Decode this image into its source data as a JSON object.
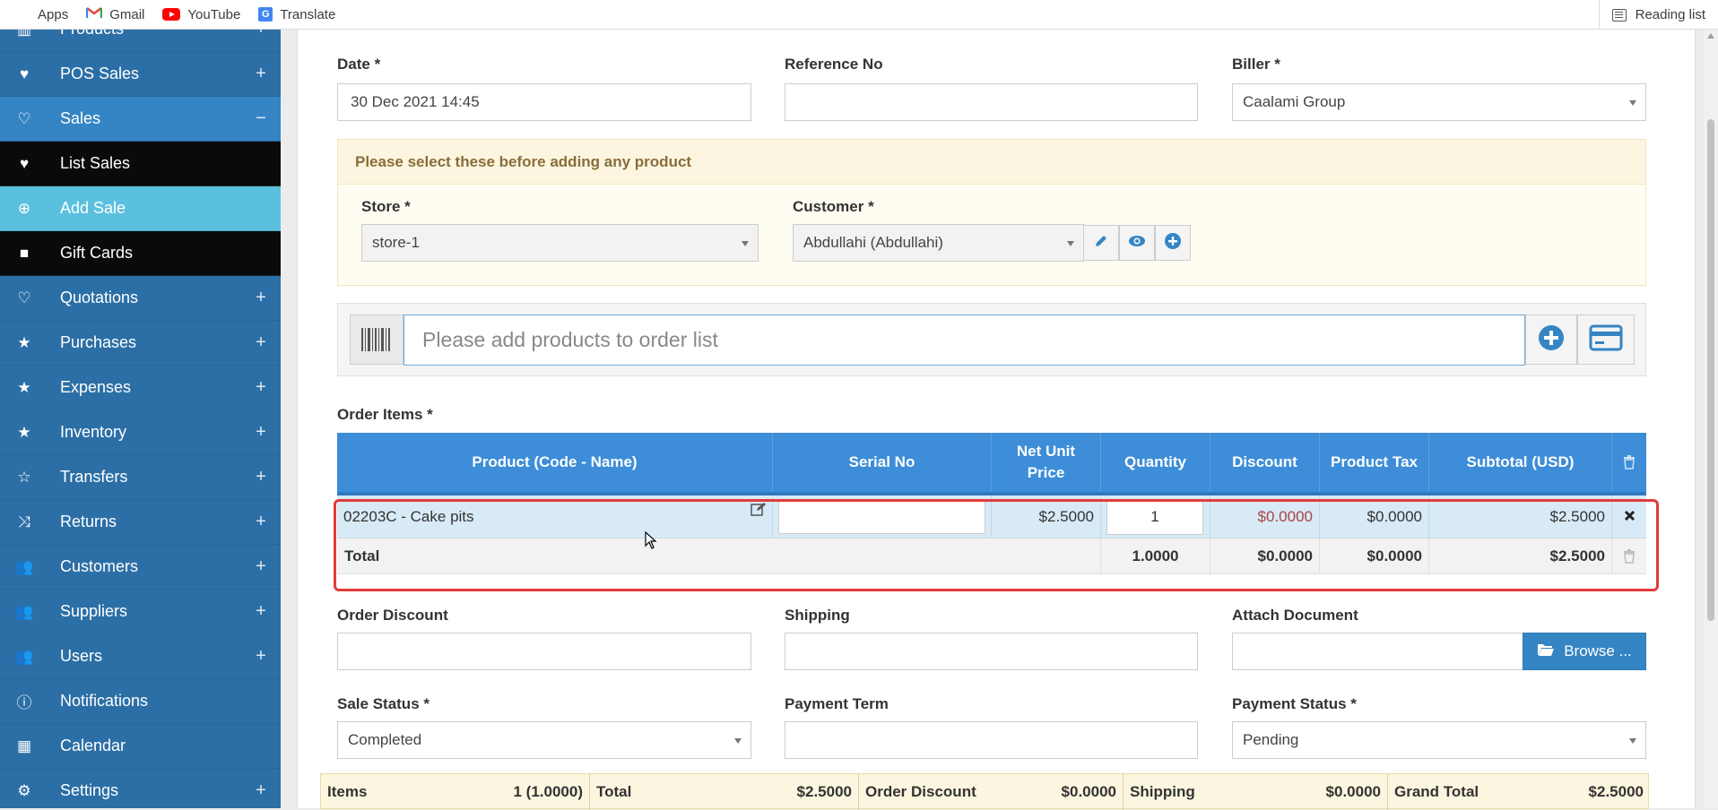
{
  "bookmarks": {
    "items": [
      {
        "label": "Apps",
        "icon": "apps-grid-icon"
      },
      {
        "label": "Gmail",
        "icon": "gmail-icon"
      },
      {
        "label": "YouTube",
        "icon": "youtube-icon"
      },
      {
        "label": "Translate",
        "icon": "translate-icon"
      }
    ],
    "reading_list": "Reading list"
  },
  "sidebar": {
    "items": [
      {
        "label": "Products",
        "icon": "products-icon",
        "toggle": "+"
      },
      {
        "label": "POS Sales",
        "icon": "heart-icon",
        "toggle": "+"
      },
      {
        "label": "Sales",
        "icon": "heart-outline-icon",
        "toggle": "−"
      },
      {
        "label": "List Sales",
        "icon": "heart-icon"
      },
      {
        "label": "Add Sale",
        "icon": "plus-circle-icon"
      },
      {
        "label": "Gift Cards",
        "icon": "gift-icon"
      },
      {
        "label": "Quotations",
        "icon": "heart-outline-icon",
        "toggle": "+"
      },
      {
        "label": "Purchases",
        "icon": "star-icon",
        "toggle": "+"
      },
      {
        "label": "Expenses",
        "icon": "star-icon",
        "toggle": "+"
      },
      {
        "label": "Inventory",
        "icon": "star-icon",
        "toggle": "+"
      },
      {
        "label": "Transfers",
        "icon": "star-outline-icon",
        "toggle": "+"
      },
      {
        "label": "Returns",
        "icon": "shuffle-icon",
        "toggle": "+"
      },
      {
        "label": "Customers",
        "icon": "users-icon",
        "toggle": "+"
      },
      {
        "label": "Suppliers",
        "icon": "users-icon",
        "toggle": "+"
      },
      {
        "label": "Users",
        "icon": "users-icon",
        "toggle": "+"
      },
      {
        "label": "Notifications",
        "icon": "info-icon"
      },
      {
        "label": "Calendar",
        "icon": "calendar-icon"
      },
      {
        "label": "Settings",
        "icon": "gear-icon",
        "toggle": "+"
      }
    ]
  },
  "form": {
    "date_label": "Date *",
    "date_value": "30 Dec 2021 14:45",
    "reference_label": "Reference No",
    "reference_value": "",
    "biller_label": "Biller *",
    "biller_value": "Caalami Group",
    "warning": "Please select these before adding any product",
    "store_label": "Store *",
    "store_value": "store-1",
    "customer_label": "Customer *",
    "customer_value": "Abdullahi (Abdullahi)",
    "product_search_placeholder": "Please add products to order list",
    "order_items_label": "Order Items *"
  },
  "table": {
    "headers": [
      "Product (Code - Name)",
      "Serial No",
      "Net Unit Price",
      "Quantity",
      "Discount",
      "Product Tax",
      "Subtotal (USD)"
    ],
    "rows": [
      {
        "product": "02203C - Cake pits",
        "serial": "",
        "net_unit_price": "$2.5000",
        "quantity": "1",
        "discount": "$0.0000",
        "product_tax": "$0.0000",
        "subtotal": "$2.5000"
      }
    ],
    "footer": {
      "label": "Total",
      "quantity": "1.0000",
      "discount": "$0.0000",
      "product_tax": "$0.0000",
      "subtotal": "$2.5000"
    },
    "discount_color": "#a94442"
  },
  "form2": {
    "order_discount_label": "Order Discount",
    "shipping_label": "Shipping",
    "attach_label": "Attach Document",
    "browse_label": "Browse ...",
    "sale_status_label": "Sale Status *",
    "sale_status_value": "Completed",
    "payment_term_label": "Payment Term",
    "payment_status_label": "Payment Status *",
    "payment_status_value": "Pending"
  },
  "totals": {
    "items_label": "Items",
    "items_value": "1 (1.0000)",
    "total_label": "Total",
    "total_value": "$2.5000",
    "order_discount_label": "Order Discount",
    "order_discount_value": "$0.0000",
    "shipping_label": "Shipping",
    "shipping_value": "$0.0000",
    "grand_total_label": "Grand Total",
    "grand_total_value": "$2.5000"
  },
  "colors": {
    "sidebar": "#2c6fa6",
    "accent": "#3585c4",
    "active_sub": "#5bc0de",
    "table_header": "#3d8dd8",
    "highlight_outline": "#e23b3b"
  }
}
